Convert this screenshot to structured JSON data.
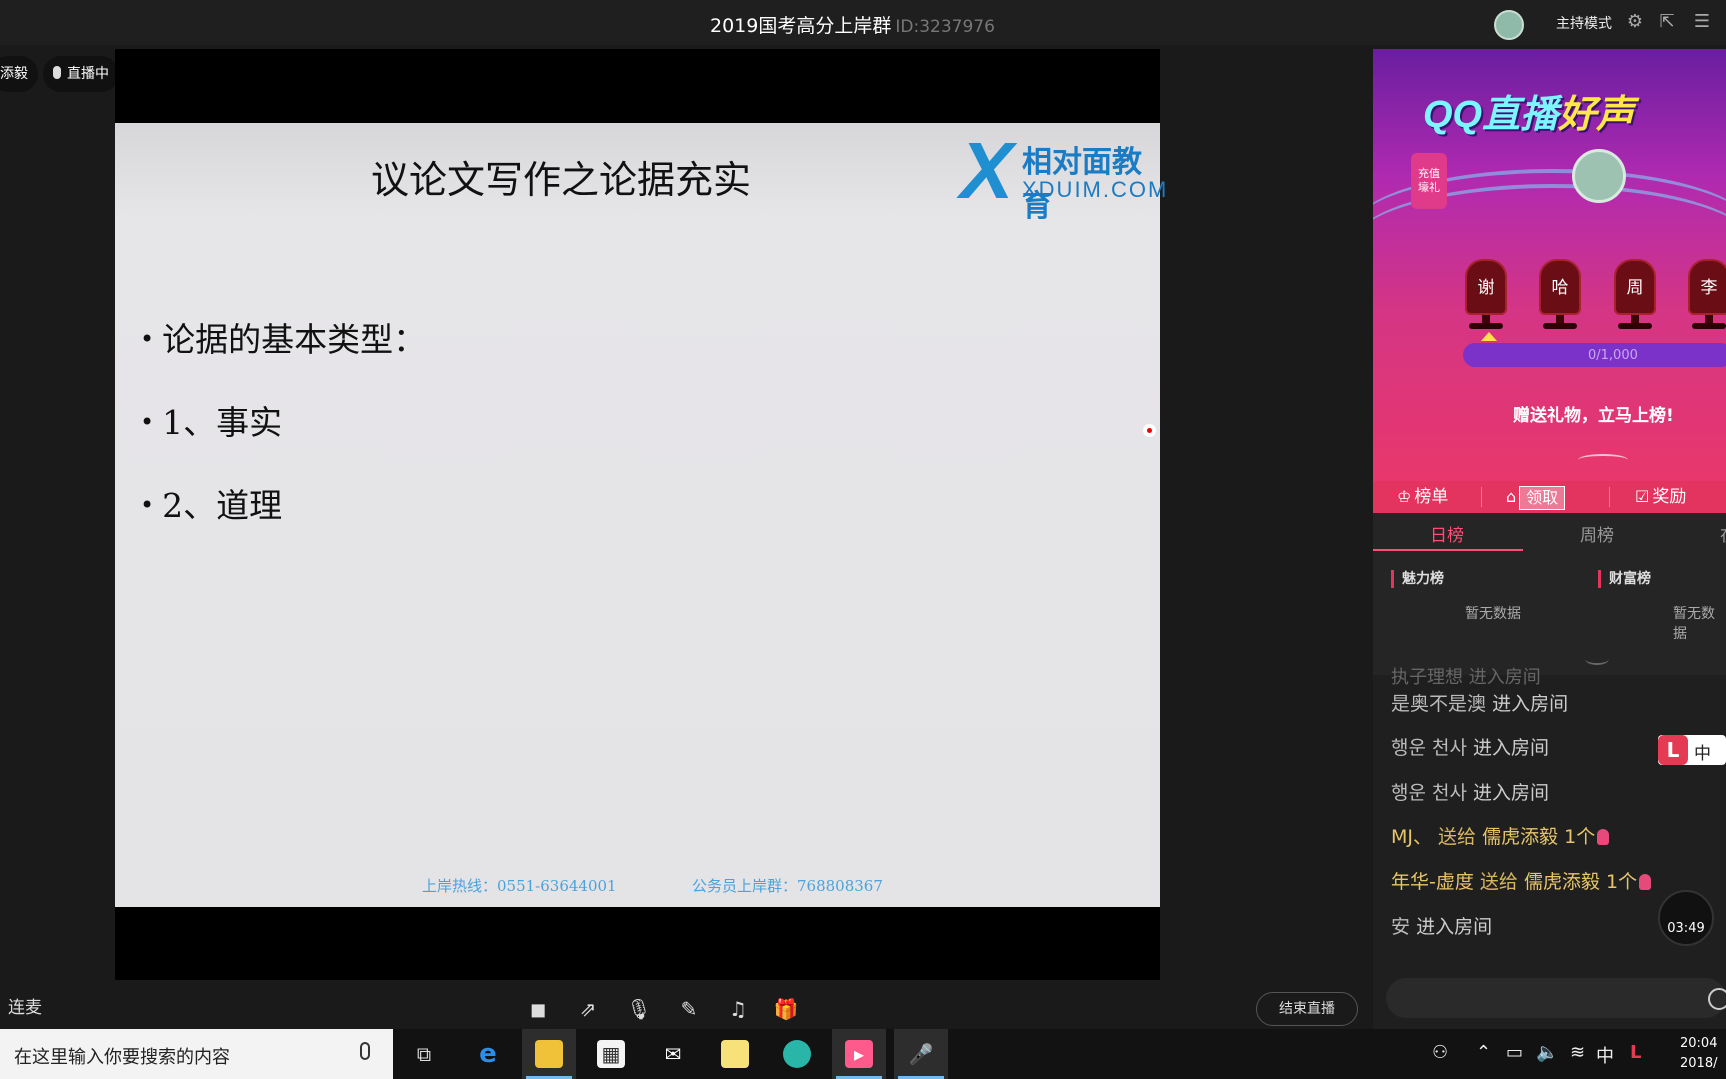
{
  "titlebar": {
    "title": "2019国考高分上岸群",
    "room_id": "ID:3237976",
    "host_mode_label": "主持模式",
    "icons": [
      "settings-icon",
      "popout-icon",
      "menu-icon"
    ]
  },
  "pills": {
    "user_partial": "添毅",
    "live_status": "直播中"
  },
  "slide": {
    "title": "议论文写作之论据充实",
    "logo_cn": "相对面教育",
    "logo_en": "XDUIM.COM",
    "bullets": [
      "论据的基本类型：",
      "1、事实",
      "2、道理"
    ],
    "footer_hotline": "上岸热线：0551-63644001",
    "footer_group": "公务员上岸群：768808367"
  },
  "toolbar": {
    "connect_label": "连麦",
    "tools": [
      "camera-off-icon",
      "share-screen-icon",
      "microphone-icon",
      "edit-icon",
      "music-icon",
      "gift-icon"
    ],
    "end_live_label": "结束直播"
  },
  "banner": {
    "title_a": "QQ直播",
    "title_b": "好声",
    "gift_badge": "充值 壕礼",
    "seats": [
      "谢",
      "哈",
      "周",
      "李"
    ],
    "progress_text": "0/1,000",
    "progress_fraction": 0,
    "promo": "赠送礼物，立马上榜!"
  },
  "tabs": {
    "rank": "榜单",
    "claim": "领取",
    "reward": "奖励"
  },
  "rank_panel": {
    "tabs": [
      "日榜",
      "周榜",
      "在"
    ],
    "charm_title": "魅力榜",
    "wealth_title": "财富榜",
    "no_data": "暂无数据",
    "no_data_right": "暂无数据"
  },
  "chat": {
    "partial_line": "执子理想 进入房间",
    "messages": [
      {
        "user": "是奥不是澳",
        "action": "进入房间"
      },
      {
        "user": "행운 천사",
        "action": "进入房间"
      },
      {
        "user": "행운 천사",
        "action": "进入房间"
      },
      {
        "user": "MJ、",
        "verb": "送给",
        "target": "儒虎添毅",
        "count": "1个"
      },
      {
        "user": "年华-虚度",
        "verb": "送给",
        "target": "儒虎添毅",
        "count": "1个"
      },
      {
        "user": "安",
        "action": "进入房间"
      }
    ],
    "float_lang": "中",
    "timer": "03:49"
  },
  "taskbar": {
    "search_placeholder": "在这里输入你要搜索的内容",
    "apps": [
      "task-view-icon",
      "edge-icon",
      "file-explorer-icon",
      "store-icon",
      "mail-icon",
      "sticky-icon",
      "app-icon",
      "qq-live-icon",
      "mic-app-icon"
    ],
    "ime": "中",
    "time": "20:04",
    "date": "2018/"
  }
}
